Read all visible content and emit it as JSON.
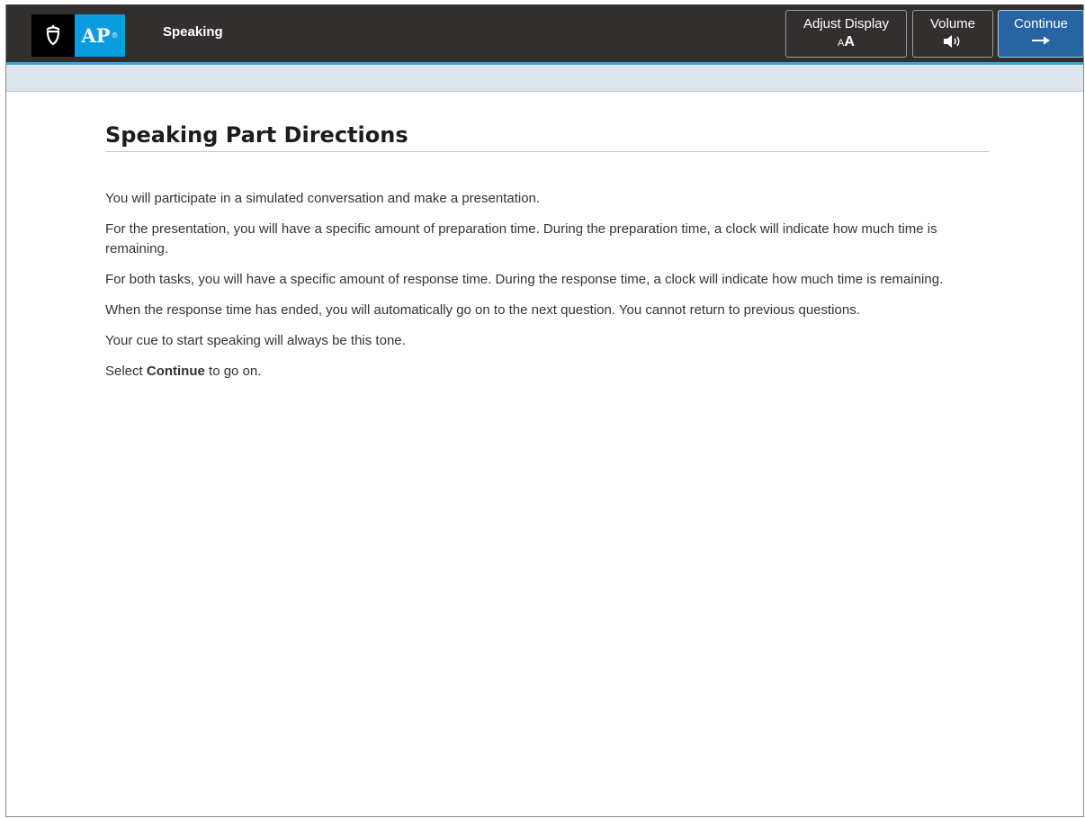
{
  "header": {
    "section_title": "Speaking",
    "logo_text": "AP",
    "logo_mark": "®",
    "buttons": {
      "adjust_display": {
        "label": "Adjust Display",
        "icon": "text-size-icon",
        "icon_small": "A",
        "icon_large": "A"
      },
      "volume": {
        "label": "Volume",
        "icon": "speaker-icon"
      },
      "continue": {
        "label": "Continue",
        "icon": "right-arrow-icon",
        "icon_glyph": "⟶"
      }
    },
    "colors": {
      "topbar": "#322f2e",
      "accent_line": "#3aa3d8",
      "logo_blue": "#099cde",
      "continue_bg": "#2764a3"
    }
  },
  "main": {
    "title": "Speaking Part Directions",
    "paragraphs": [
      "You will participate in a simulated conversation and make a presentation.",
      "For the presentation, you will have a specific amount of preparation time. During the preparation time, a clock will indicate how much time is remaining.",
      "For both tasks, you will have a specific amount of response time. During the response time, a clock will indicate how much time is remaining.",
      "When the response time has ended, you will automatically go on to the next question. You cannot return to previous questions.",
      "Your cue to start speaking will always be this tone."
    ],
    "final_line": {
      "prefix": "Select ",
      "bold": "Continue",
      "suffix": " to go on."
    }
  }
}
